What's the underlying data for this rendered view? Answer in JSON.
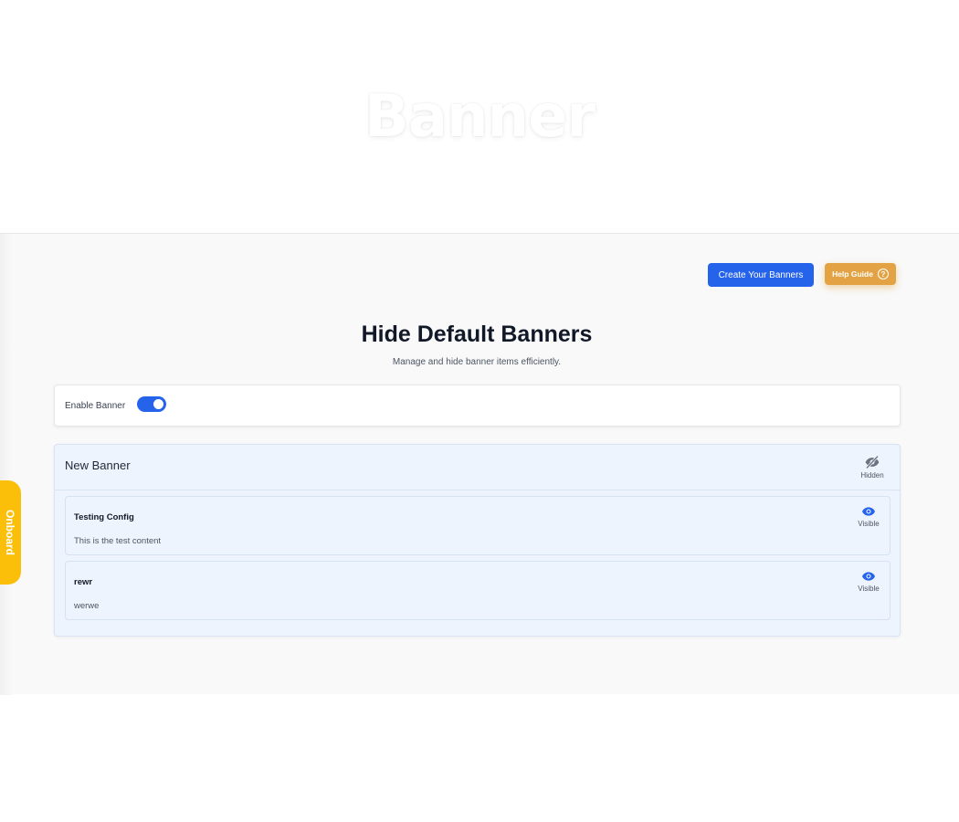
{
  "hero": {
    "title": "Banner"
  },
  "toolbar": {
    "create_label": "Create Your Banners",
    "help_label": "Help Guide",
    "help_icon_glyph": "?"
  },
  "page": {
    "title": "Hide Default Banners",
    "subtitle": "Manage and hide banner items efficiently."
  },
  "enable": {
    "label": "Enable Banner",
    "on": true
  },
  "group": {
    "title": "New Banner",
    "status": "Hidden",
    "status_icon": "eye-slash-icon",
    "items": [
      {
        "title": "Testing Config",
        "content": "This is the test content",
        "status": "Visible",
        "status_icon": "eye-icon"
      },
      {
        "title": "rewr",
        "content": "werwe",
        "status": "Visible",
        "status_icon": "eye-icon"
      }
    ]
  },
  "onboard": {
    "label": "Onboard"
  },
  "colors": {
    "primary": "#2563eb",
    "help": "#e3a344",
    "onboard": "#fbbf09",
    "hidden_icon": "#6b7280"
  }
}
